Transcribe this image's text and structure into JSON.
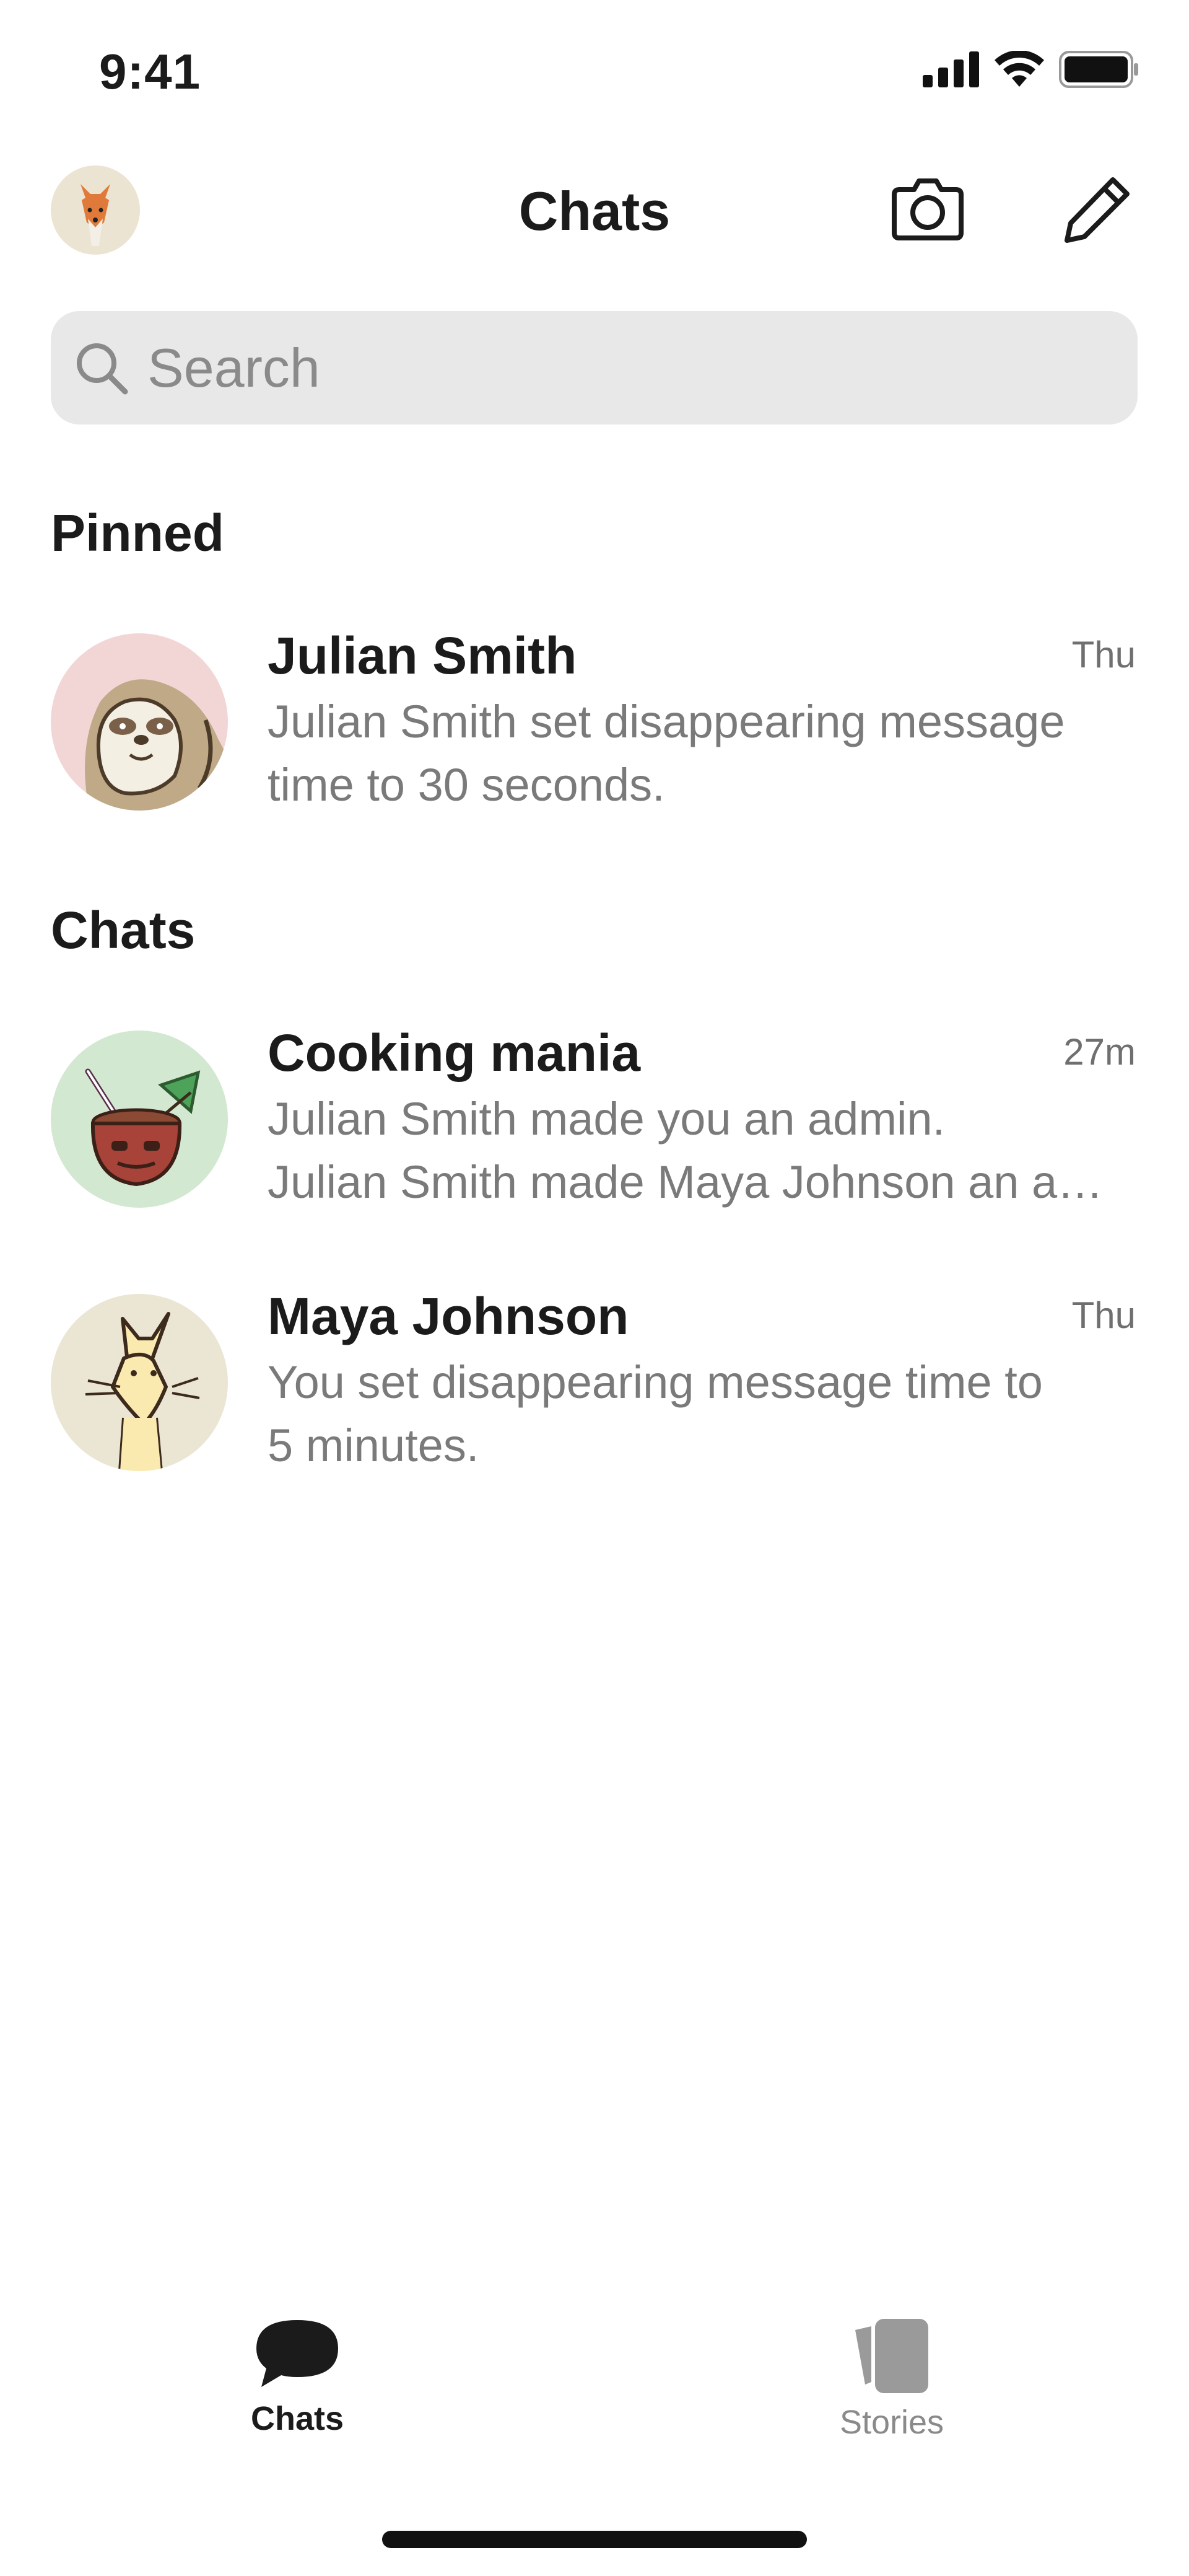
{
  "status_bar": {
    "time": "9:41"
  },
  "header": {
    "title": "Chats"
  },
  "search": {
    "placeholder": "Search"
  },
  "sections": {
    "pinned": "Pinned",
    "chats": "Chats"
  },
  "pinned_chats": [
    {
      "name": "Julian Smith",
      "time": "Thu",
      "preview": [
        "Julian  Smith set disappearing message",
        "time to 30 seconds."
      ],
      "avatar_icon": "sloth-avatar",
      "avatar_bg": "#f2d6d6"
    }
  ],
  "chats": [
    {
      "name": "Cooking mania",
      "time": "27m",
      "preview": [
        "Julian Smith made you an admin.",
        "Julian Smith made Maya Johnson an a…"
      ],
      "avatar_icon": "coconut-drink-avatar",
      "avatar_bg": "#d3e8d0"
    },
    {
      "name": "Maya Johnson",
      "time": "Thu",
      "preview": [
        "You set disappearing message time to",
        "5 minutes."
      ],
      "avatar_icon": "fox-avatar",
      "avatar_bg": "#ebe5d3"
    }
  ],
  "tabs": [
    {
      "label": "Chats",
      "icon": "chat-bubble-icon",
      "active": true
    },
    {
      "label": "Stories",
      "icon": "stories-icon",
      "active": false
    }
  ],
  "colors": {
    "text_primary": "#1b1b1b",
    "text_secondary": "#7a7a7a",
    "search_bg": "#e8e8e8",
    "tab_inactive": "#8a8a8a"
  }
}
